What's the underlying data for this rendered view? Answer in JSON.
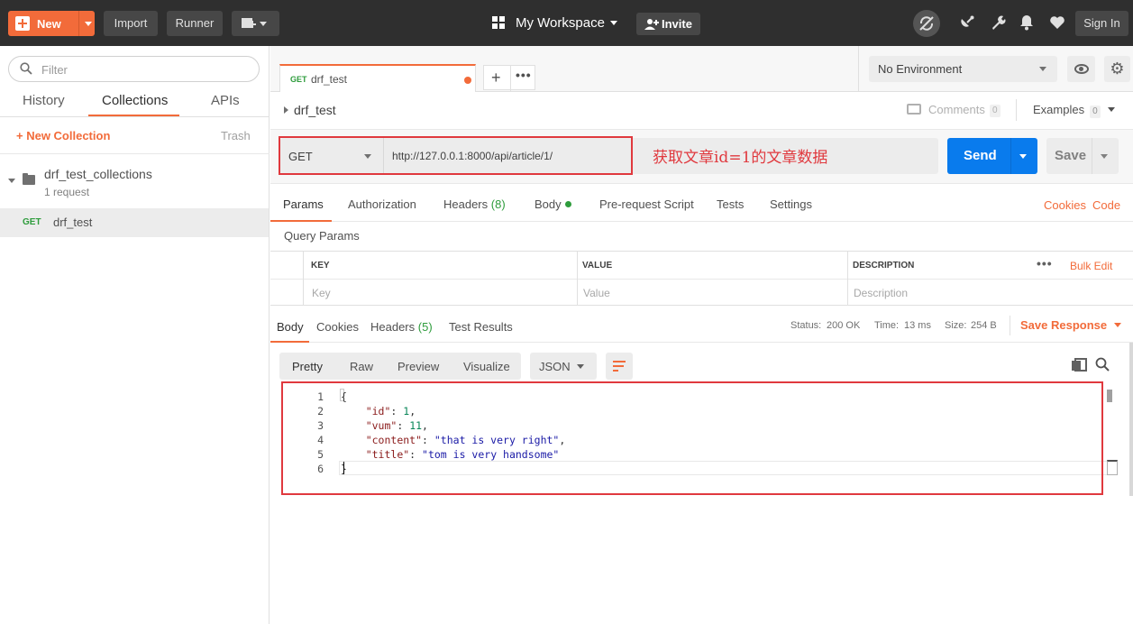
{
  "header": {
    "new_label": "New",
    "import_label": "Import",
    "runner_label": "Runner",
    "workspace_label": "My Workspace",
    "invite_label": "Invite",
    "signin_label": "Sign In"
  },
  "sidebar": {
    "filter_placeholder": "Filter",
    "tabs": [
      {
        "label": "History"
      },
      {
        "label": "Collections",
        "active": true
      },
      {
        "label": "APIs"
      }
    ],
    "new_collection_label": "+ New Collection",
    "trash_label": "Trash",
    "collection": {
      "name": "drf_test_collections",
      "count": "1 request"
    },
    "request": {
      "method": "GET",
      "name": "drf_test"
    }
  },
  "request_tab": {
    "method": "GET",
    "name": "drf_test"
  },
  "environment": {
    "selected": "No Environment"
  },
  "breadcrumb": "drf_test",
  "comments": {
    "label": "Comments",
    "count": "0"
  },
  "examples": {
    "label": "Examples",
    "count": "0"
  },
  "url_bar": {
    "method": "GET",
    "url": "http://127.0.0.1:8000/api/article/1/",
    "annotation": "获取文章id=1的文章数据",
    "send_label": "Send",
    "save_label": "Save"
  },
  "request_tabs": [
    {
      "label": "Params",
      "active": true
    },
    {
      "label": "Authorization"
    },
    {
      "label": "Headers",
      "count": "(8)"
    },
    {
      "label": "Body"
    },
    {
      "label": "Pre-request Script"
    },
    {
      "label": "Tests"
    },
    {
      "label": "Settings"
    }
  ],
  "links": {
    "cookies": "Cookies",
    "code": "Code"
  },
  "query_params": {
    "title": "Query Params",
    "headers": [
      "KEY",
      "VALUE",
      "DESCRIPTION"
    ],
    "placeholders": [
      "Key",
      "Value",
      "Description"
    ],
    "bulk_edit": "Bulk Edit"
  },
  "response_tabs": [
    {
      "label": "Body",
      "active": true
    },
    {
      "label": "Cookies"
    },
    {
      "label": "Headers",
      "count": "(5)"
    },
    {
      "label": "Test Results"
    }
  ],
  "response_status": {
    "status_label": "Status:",
    "status_value": "200 OK",
    "time_label": "Time:",
    "time_value": "13 ms",
    "size_label": "Size:",
    "size_value": "254 B",
    "save_response": "Save Response"
  },
  "format_tabs": [
    {
      "label": "Pretty",
      "active": true
    },
    {
      "label": "Raw"
    },
    {
      "label": "Preview"
    },
    {
      "label": "Visualize"
    }
  ],
  "format_select": "JSON",
  "response_code": [
    {
      "n": "1",
      "text": "{"
    },
    {
      "n": "2",
      "key": "\"id\"",
      "value": "1",
      "type": "num",
      "comma": ","
    },
    {
      "n": "3",
      "key": "\"vum\"",
      "value": "11",
      "type": "num",
      "comma": ","
    },
    {
      "n": "4",
      "key": "\"content\"",
      "value": "\"that is very right\"",
      "type": "str",
      "comma": ","
    },
    {
      "n": "5",
      "key": "\"title\"",
      "value": "\"tom is very handsome\"",
      "type": "str",
      "comma": ""
    },
    {
      "n": "6",
      "text": "}"
    }
  ],
  "colors": {
    "accent": "#f26b3a",
    "send": "#097bed",
    "success": "#2e9c3c",
    "annotation": "#e0393e"
  }
}
